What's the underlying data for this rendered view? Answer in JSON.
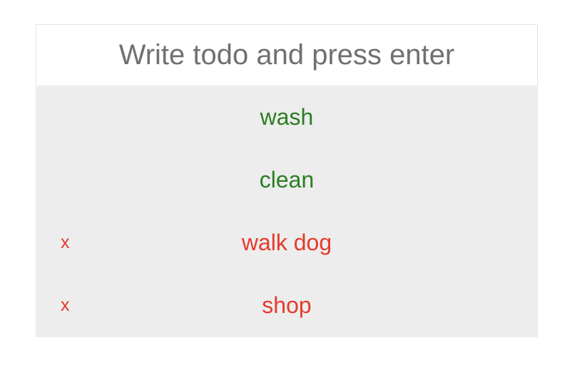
{
  "input": {
    "placeholder": "Write todo and press enter",
    "value": ""
  },
  "todos": [
    {
      "text": "wash",
      "completed": true,
      "delete_label": ""
    },
    {
      "text": "clean",
      "completed": true,
      "delete_label": ""
    },
    {
      "text": "walk dog",
      "completed": false,
      "delete_label": "x"
    },
    {
      "text": "shop",
      "completed": false,
      "delete_label": "x"
    }
  ],
  "colors": {
    "completed": "#2a7d21",
    "pending": "#e53b2c",
    "list_background": "#ededed",
    "placeholder": "#707070"
  }
}
